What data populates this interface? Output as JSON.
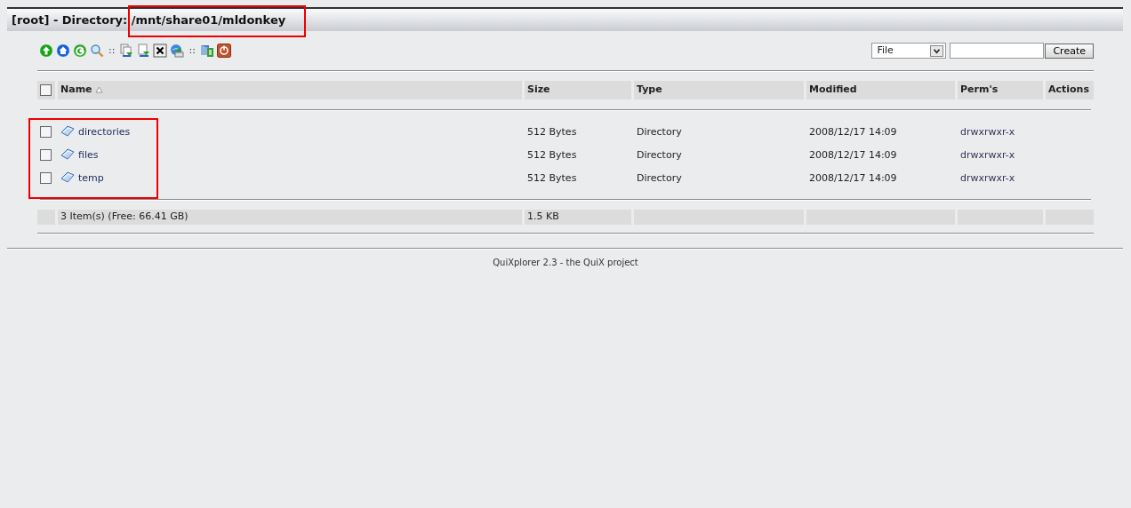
{
  "title": {
    "prefix": "[root] - Directory:",
    "path": "/mnt/share01/mldonkey",
    "path_highlighted": true
  },
  "toolbar": [
    {
      "kind": "up"
    },
    {
      "kind": "home"
    },
    {
      "kind": "reload"
    },
    {
      "kind": "search"
    },
    {
      "kind": "separator",
      "label": "::"
    },
    {
      "kind": "copy"
    },
    {
      "kind": "move"
    },
    {
      "kind": "delete"
    },
    {
      "kind": "upload"
    },
    {
      "kind": "separator",
      "label": "::"
    },
    {
      "kind": "admin"
    },
    {
      "kind": "logout"
    }
  ],
  "create": {
    "type_value": "File",
    "button": "Create"
  },
  "table": {
    "columns": [
      {
        "label": "Name",
        "sorted": true
      },
      {
        "label": "Size",
        "sorted": false
      },
      {
        "label": "Type",
        "sorted": false
      },
      {
        "label": "Modified",
        "sorted": false
      },
      {
        "label": "Perm's",
        "sorted": false
      },
      {
        "label": "Actions",
        "sorted": false
      }
    ],
    "select_all_checked": false,
    "names_highlighted": true,
    "rows": [
      {
        "name": "directories",
        "size": "512 Bytes",
        "type": "Directory",
        "modified": "2008/12/17 14:09",
        "perms": "drwxrwxr-x",
        "checked": false
      },
      {
        "name": "files",
        "size": "512 Bytes",
        "type": "Directory",
        "modified": "2008/12/17 14:09",
        "perms": "drwxrwxr-x",
        "checked": false
      },
      {
        "name": "temp",
        "size": "512 Bytes",
        "type": "Directory",
        "modified": "2008/12/17 14:09",
        "perms": "drwxrwxr-x",
        "checked": false
      }
    ],
    "summary": {
      "items": "3 Item(s) (Free: 66.41 GB)",
      "size": "1.5 KB"
    }
  },
  "footer": "QuiXplorer 2.3 - the QuiX project"
}
